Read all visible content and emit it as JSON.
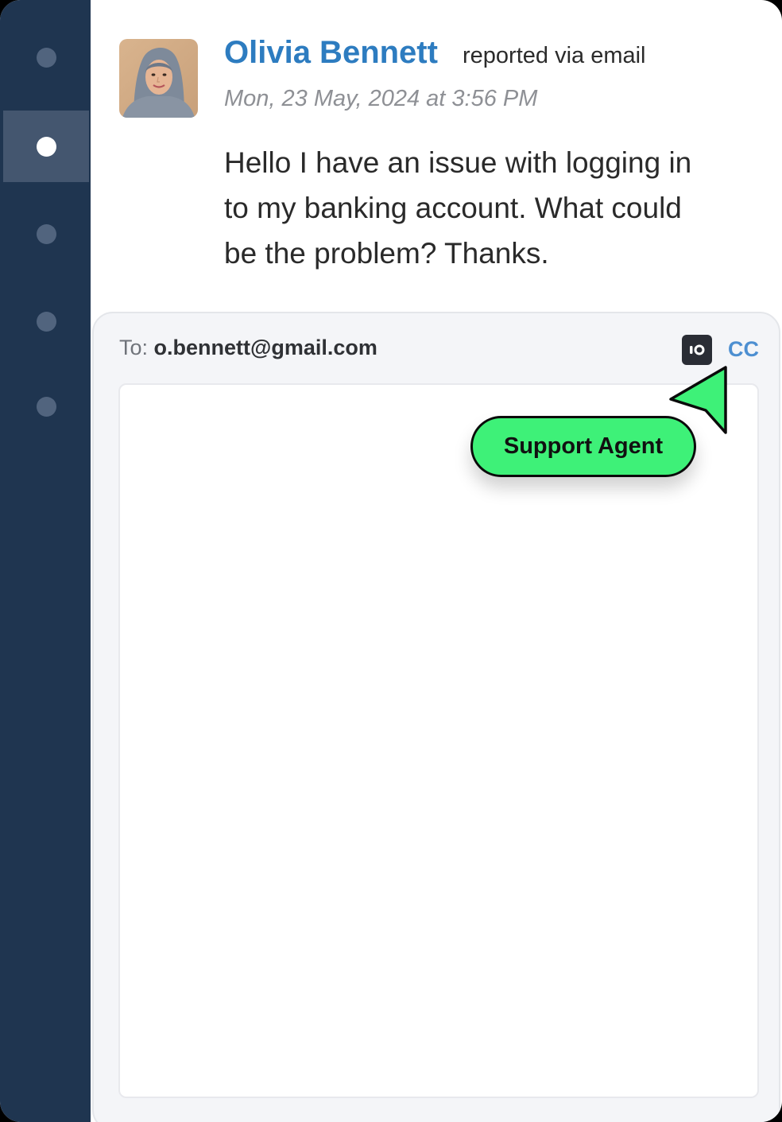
{
  "sidebar": {
    "items": [
      {
        "name": "nav-item-1",
        "active": false
      },
      {
        "name": "nav-item-2",
        "active": true
      },
      {
        "name": "nav-item-3",
        "active": false
      },
      {
        "name": "nav-item-4",
        "active": false
      },
      {
        "name": "nav-item-5",
        "active": false
      }
    ]
  },
  "ticket": {
    "sender_name": "Olivia Bennett",
    "sender_meta": "reported via email",
    "timestamp": "Mon, 23 May, 2024 at 3:56 PM",
    "message": "Hello I have an issue with logging in to my banking account. What could be the problem?  Thanks."
  },
  "reply": {
    "to_label": "To:",
    "to_email": "o.bennett@gmail.com",
    "record_icon": "record-icon",
    "cc_label": "CC",
    "editor_value": ""
  },
  "cursor": {
    "label": "Support Agent",
    "color": "#3ef178"
  },
  "colors": {
    "sidebar": "#1f3550",
    "accent": "#2d7cc0",
    "cc": "#4d8fd1"
  }
}
